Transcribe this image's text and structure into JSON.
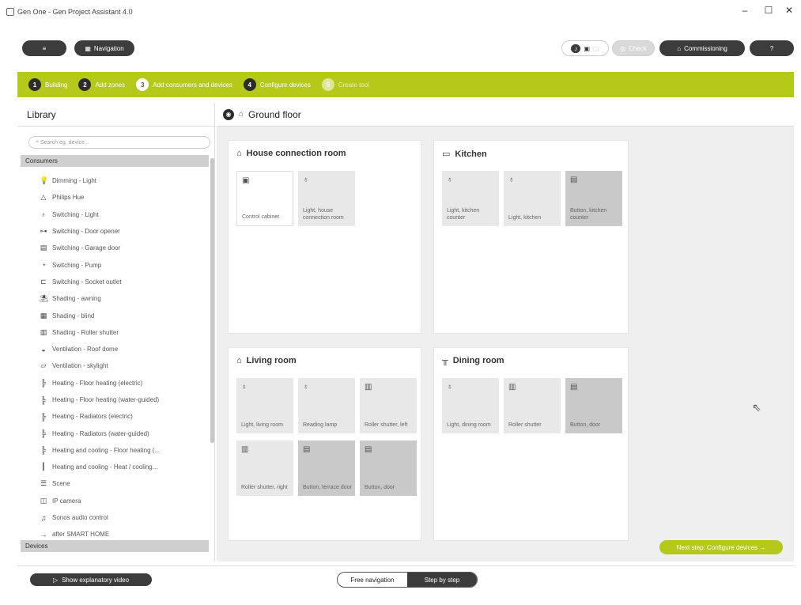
{
  "window": {
    "title": "Gen One - Gen Project Assistant 4.0",
    "min": "–",
    "max": "☐",
    "close": "✕"
  },
  "topbar": {
    "menu_icon": "menu-icon",
    "navigation_label": "Navigation",
    "check_label": "Check",
    "commissioning_label": "Commissioning",
    "help_label": "?"
  },
  "steps": [
    {
      "num": "1",
      "label": "Building",
      "state": "done"
    },
    {
      "num": "2",
      "label": "Add zones",
      "state": "done"
    },
    {
      "num": "3",
      "label": "Add consumers and devices",
      "state": "active"
    },
    {
      "num": "4",
      "label": "Configure devices",
      "state": "done"
    },
    {
      "num": "5",
      "label": "Create tool",
      "state": "future"
    }
  ],
  "library": {
    "title": "Library",
    "search_placeholder": "Search eg. device...",
    "consumers_label": "Consumers",
    "devices_label": "Devices",
    "items": [
      {
        "icon": "bulb-icon",
        "glyph": "💡",
        "label": "Dimming - Light"
      },
      {
        "icon": "hue-icon",
        "glyph": "△",
        "label": "Philips Hue"
      },
      {
        "icon": "bulb-icon",
        "glyph": "♁",
        "label": "Switching - Light"
      },
      {
        "icon": "key-icon",
        "glyph": "⊶",
        "label": "Switching - Door opener"
      },
      {
        "icon": "garage-icon",
        "glyph": "▤",
        "label": "Switching - Garage door"
      },
      {
        "icon": "pump-icon",
        "glyph": "◔",
        "label": "Switching - Pump"
      },
      {
        "icon": "socket-icon",
        "glyph": "⊏",
        "label": "Switching - Socket outlet"
      },
      {
        "icon": "awning-icon",
        "glyph": "⛱",
        "label": "Shading - awning"
      },
      {
        "icon": "blind-icon",
        "glyph": "▦",
        "label": "Shading - blind"
      },
      {
        "icon": "shutter-icon",
        "glyph": "▥",
        "label": "Shading - Roller shutter"
      },
      {
        "icon": "dome-icon",
        "glyph": "◒",
        "label": "Ventilation - Roof dome"
      },
      {
        "icon": "skylight-icon",
        "glyph": "▱",
        "label": "Ventilation - skylight"
      },
      {
        "icon": "heating-icon",
        "glyph": "╠",
        "label": "Heating - Floor heating (electric)"
      },
      {
        "icon": "heating-icon",
        "glyph": "╠",
        "label": "Heating - Floor heating (water-guided)"
      },
      {
        "icon": "radiator-icon",
        "glyph": "╠",
        "label": "Heating - Radiators (electric)"
      },
      {
        "icon": "radiator-icon",
        "glyph": "╠",
        "label": "Heating - Radiators (water-guided)"
      },
      {
        "icon": "heatcool-icon",
        "glyph": "╠",
        "label": "Heating and cooling - Floor heating (..."
      },
      {
        "icon": "heatcool-icon",
        "glyph": "┃",
        "label": "Heating and cooling - Heat / cooling..."
      },
      {
        "icon": "scene-icon",
        "glyph": "☰",
        "label": "Scene"
      },
      {
        "icon": "camera-icon",
        "glyph": "◫",
        "label": "IP camera"
      },
      {
        "icon": "audio-icon",
        "glyph": "♫",
        "label": "Sonos audio control"
      },
      {
        "icon": "arrow-right-icon",
        "glyph": "→",
        "label": "after SMART HOME"
      }
    ]
  },
  "canvas": {
    "floor_label": "Ground floor",
    "rooms": [
      {
        "name": "House connection room",
        "glyph": "⌂",
        "devices": [
          {
            "label": "Control cabinet",
            "glyph": "▣",
            "style": "white"
          },
          {
            "label": "Light, house connection room",
            "glyph": "♁",
            "style": "light"
          }
        ]
      },
      {
        "name": "Kitchen",
        "glyph": "▭",
        "devices": [
          {
            "label": "Light, kitchen counter",
            "glyph": "♁",
            "style": "light"
          },
          {
            "label": "Light, kitchen",
            "glyph": "♁",
            "style": "light"
          },
          {
            "label": "Button, kitchen counter",
            "glyph": "▤",
            "style": "dark"
          }
        ]
      },
      {
        "name": "Living room",
        "glyph": "⌂",
        "devices": [
          {
            "label": "Light, living room",
            "glyph": "♁",
            "style": "light"
          },
          {
            "label": "Reading lamp",
            "glyph": "♁",
            "style": "light"
          },
          {
            "label": "Roller shutter, left",
            "glyph": "▥",
            "style": "light"
          },
          {
            "label": "Roller shutter, right",
            "glyph": "▥",
            "style": "light"
          },
          {
            "label": "Button, terrace door",
            "glyph": "▤",
            "style": "dark"
          },
          {
            "label": "Button, door",
            "glyph": "▤",
            "style": "dark"
          }
        ]
      },
      {
        "name": "Dining room",
        "glyph": "╥",
        "devices": [
          {
            "label": "Light, dining room",
            "glyph": "♁",
            "style": "light"
          },
          {
            "label": "Roller shutter",
            "glyph": "▥",
            "style": "light"
          },
          {
            "label": "Button, door",
            "glyph": "▤",
            "style": "dark"
          }
        ]
      }
    ],
    "next_step_label": "Next step: Configure devices →"
  },
  "bottom": {
    "video_label": "Show explanatory video",
    "free_nav_label": "Free navigation",
    "step_by_step_label": "Step by step"
  },
  "colors": {
    "accent": "#b4c91a",
    "dark": "#3c3c3c"
  }
}
